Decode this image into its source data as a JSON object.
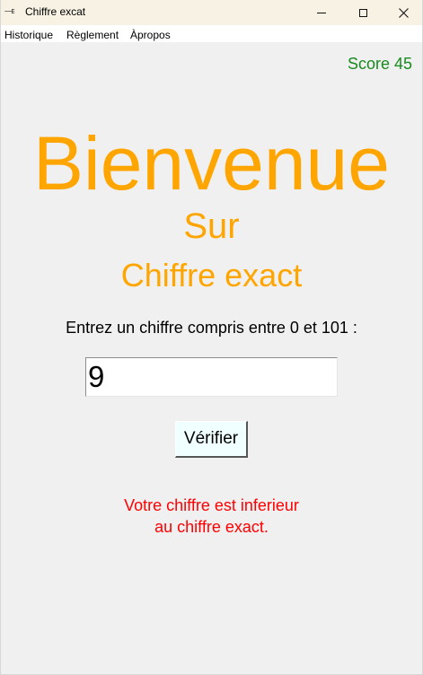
{
  "window": {
    "title": "Chiffre excat",
    "icon_text": "~~E",
    "min_icon": "minimize-icon",
    "max_icon": "maximize-icon",
    "close_icon": "close-icon",
    "close_glyph": "✕"
  },
  "menubar": {
    "items": [
      {
        "label": "Historique"
      },
      {
        "label": "Règlement"
      },
      {
        "label": "Àpropos"
      }
    ]
  },
  "score": {
    "text": "Score 45",
    "color": "#198a1e"
  },
  "heading": {
    "welcome": "Bienvenue",
    "sur": "Sur",
    "app_name": "Chiffre exact",
    "color": "#ffa500"
  },
  "prompt": {
    "text": "Entrez un chiffre compris entre 0 et 101 :"
  },
  "guess_input": {
    "value": "9"
  },
  "verify_button": {
    "label": "Vérifier"
  },
  "feedback": {
    "line1": "Votre chiffre est inferieur",
    "line2": "au chiffre exact.",
    "color": "#ff0000"
  }
}
